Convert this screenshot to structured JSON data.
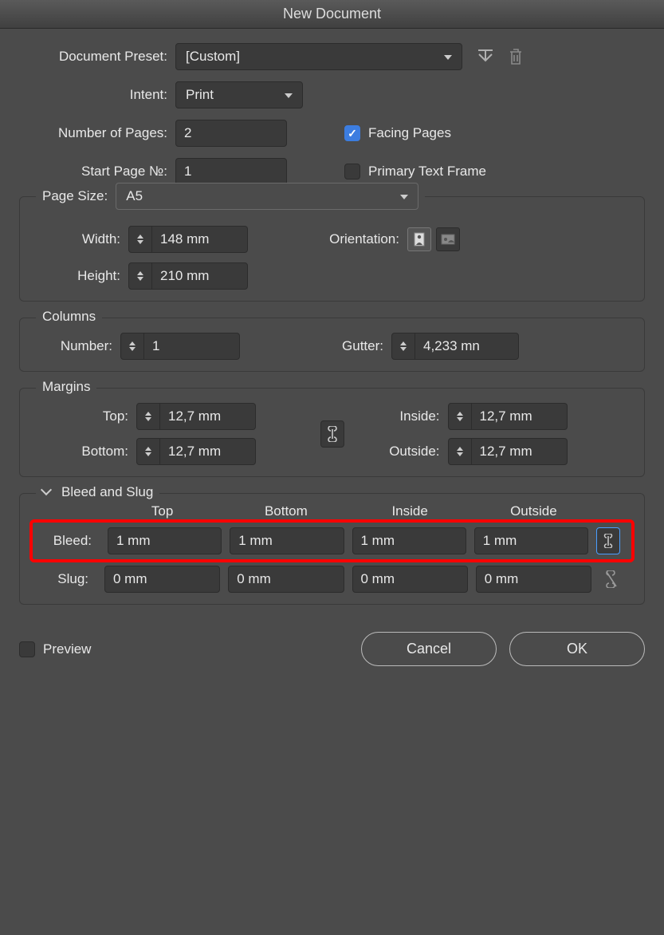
{
  "title": "New Document",
  "labels": {
    "documentPreset": "Document Preset:",
    "intent": "Intent:",
    "numberOfPages": "Number of Pages:",
    "startPage": "Start Page №:",
    "facingPages": "Facing Pages",
    "primaryTextFrame": "Primary Text Frame",
    "pageSize": "Page Size:",
    "width": "Width:",
    "height": "Height:",
    "orientation": "Orientation:",
    "columns": "Columns",
    "number": "Number:",
    "gutter": "Gutter:",
    "margins": "Margins",
    "top": "Top:",
    "bottom": "Bottom:",
    "inside": "Inside:",
    "outside": "Outside:",
    "bleedAndSlug": "Bleed and Slug",
    "colTop": "Top",
    "colBottom": "Bottom",
    "colInside": "Inside",
    "colOutside": "Outside",
    "bleed": "Bleed:",
    "slug": "Slug:",
    "preview": "Preview",
    "cancel": "Cancel",
    "ok": "OK"
  },
  "values": {
    "documentPreset": "[Custom]",
    "intent": "Print",
    "numberOfPages": "2",
    "startPage": "1",
    "facingPagesChecked": true,
    "primaryTextFrameChecked": false,
    "pageSize": "A5",
    "width": "148 mm",
    "height": "210 mm",
    "orientation": "portrait",
    "columnsNumber": "1",
    "gutter": "4,233 mn",
    "marginTop": "12,7 mm",
    "marginBottom": "12,7 mm",
    "marginInside": "12,7 mm",
    "marginOutside": "12,7 mm",
    "marginsLinked": true,
    "bleedTop": "1 mm",
    "bleedBottom": "1 mm",
    "bleedInside": "1 mm",
    "bleedOutside": "1 mm",
    "bleedLinked": true,
    "slugTop": "0 mm",
    "slugBottom": "0 mm",
    "slugInside": "0 mm",
    "slugOutside": "0 mm",
    "slugLinked": false,
    "previewChecked": false
  }
}
